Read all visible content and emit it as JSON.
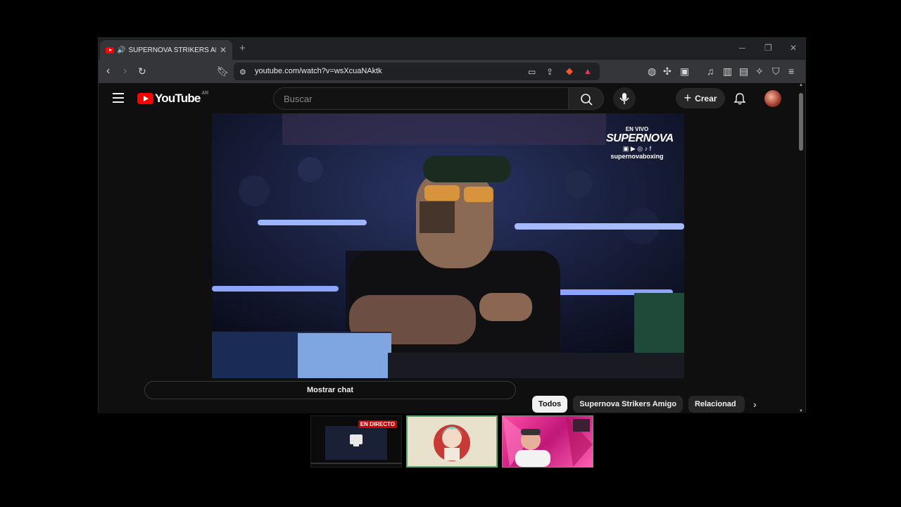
{
  "browser": {
    "tab_title": "SUPERNOVA STRIKERS AMIGO",
    "tab_audio_icon": "speaker-icon",
    "url": "youtube.com/watch?v=wsXcuaNAktk"
  },
  "youtube": {
    "logo_text": "YouTube",
    "country_code": "AR",
    "search_placeholder": "Buscar",
    "create_label": "Crear",
    "video_overlay": {
      "live_text": "EN VIVO",
      "brand": "SUPERNOVA",
      "handle": "supernovaboxing"
    },
    "show_chat_label": "Mostrar chat",
    "chips": [
      "Todos",
      "Supernova Strikers Amigo",
      "Relacionad"
    ]
  },
  "taskbar_previews": {
    "live_badge": "EN DIRECTO"
  },
  "colors": {
    "accent_red": "#ff0000",
    "live_red": "#cc0000",
    "page_bg": "#0f0f0f"
  }
}
